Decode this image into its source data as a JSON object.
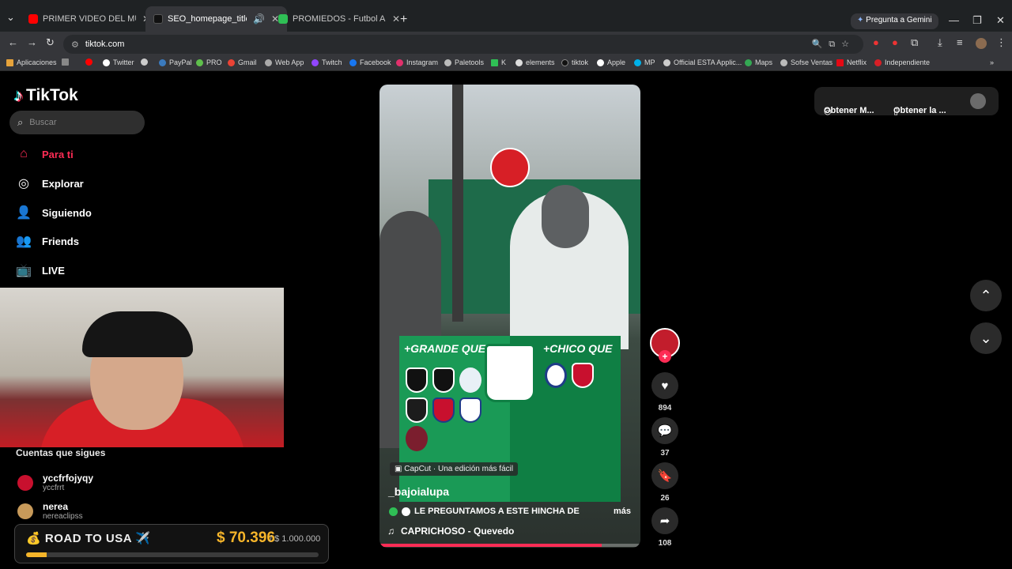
{
  "browser": {
    "tabs": [
      {
        "title": "PRIMER VIDEO DEL MUNDO AL"
      },
      {
        "title": "SEO_homepage_title"
      },
      {
        "title": "PROMIEDOS - Futbol Argentino"
      }
    ],
    "url": "tiktok.com",
    "gemini": "Pregunta a Gemini",
    "bookmarks": [
      "Aplicaciones",
      "Twitter",
      "PayPal",
      "PRO",
      "Gmail",
      "Web App",
      "Twitch",
      "Facebook",
      "Instagram",
      "Paletools",
      "K",
      "elements",
      "tiktok",
      "Apple",
      "MP",
      "Official ESTA Applic...",
      "Maps",
      "Sofse Ventas",
      "Netflix",
      "Independiente"
    ]
  },
  "tiktok": {
    "logo": "TikTok",
    "search_placeholder": "Buscar",
    "nav": [
      "Para ti",
      "Explorar",
      "Siguiendo",
      "Friends",
      "LIVE"
    ],
    "following_title": "Cuentas que sigues",
    "accounts": [
      {
        "name": "yccfrfojyqy",
        "handle": "yccfrrt"
      },
      {
        "name": "nerea",
        "handle": "nereaclipss"
      }
    ],
    "top_buttons": [
      "Obtener M...",
      "Obtener la ..."
    ],
    "video": {
      "capcut": "CapCut · Una edición más fácil",
      "author": "_bajoialupa",
      "description": "LE PREGUNTAMOS A ESTE HINCHA DE",
      "more": "más",
      "song": "CAPRICHOSO - Quevedo",
      "graphic_left": "+GRANDE QUE",
      "graphic_right": "+CHICO QUE",
      "progress": 0.85
    },
    "actions": {
      "likes": "894",
      "comments": "37",
      "saves": "26",
      "shares": "108"
    }
  },
  "overlay": {
    "label": "ROAD TO USA ✈️",
    "amount": "$ 70.396",
    "goal": "/ $ 1.000.000",
    "progress": 0.07
  }
}
